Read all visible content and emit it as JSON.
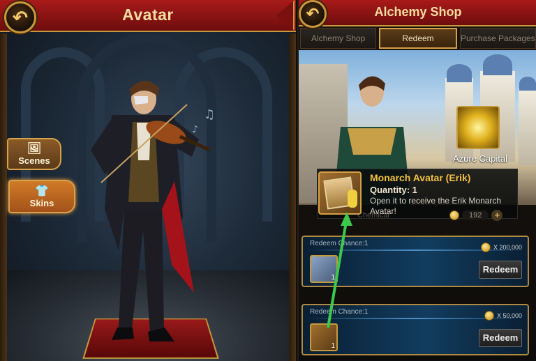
{
  "avatar_panel": {
    "title": "Avatar",
    "side_buttons": [
      {
        "label": "Scenes",
        "icon": "image-icon"
      },
      {
        "label": "Skins",
        "icon": "shirt-icon"
      }
    ]
  },
  "shop_panel": {
    "title": "Alchemy Shop",
    "tabs": [
      {
        "label": "Alchemy Shop",
        "active": false
      },
      {
        "label": "Redeem",
        "active": true
      },
      {
        "label": "Purchase Packages",
        "active": false
      }
    ],
    "featured_reward": {
      "name": "Azure Capital"
    },
    "tooltip": {
      "title": "Monarch Avatar (Erik)",
      "quantity": "Quantity: 1",
      "description": "Open it to receive the Erik Monarch Avatar!"
    },
    "balance": {
      "label": "Chemical",
      "value": "192"
    },
    "redeem_cards": [
      {
        "header": "Redeem Chance:1",
        "cost": "X 200,000",
        "item_qty": "1",
        "button": "Redeem"
      },
      {
        "header": "Redeem Chance:1",
        "cost": "X 50,000",
        "item_qty": "1",
        "button": "Redeem"
      }
    ]
  },
  "colors": {
    "header_red": "#a81a1a",
    "gold_border": "#c49a3c",
    "tooltip_title": "#f0c040",
    "arrow_green": "#3cc84a"
  }
}
